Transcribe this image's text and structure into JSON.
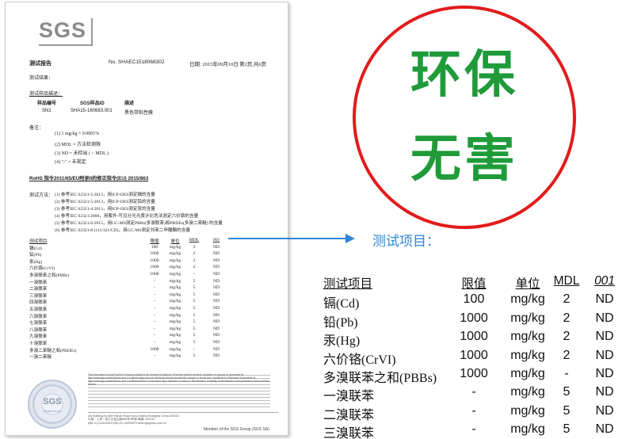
{
  "report": {
    "logo": "SGS",
    "title": "测试报告",
    "report_no": "No. SHAEC1518068302",
    "date": "日期: 2015年09月10日",
    "page": "第2页,共6页",
    "results_label": "测试结果：",
    "sample_desc_label": "测试样品描述：",
    "sample_headers": [
      "样品编号",
      "SGS样品ID",
      "描述"
    ],
    "sample_values": [
      "SN1",
      "SHA15-180683.001",
      "黑色带粘性膜"
    ],
    "notes_label": "备注：",
    "notes": [
      "(1) 1 mg/kg = 0.0001%",
      "(2) MDL = 方法检测限",
      "(3) ND = 未检出 ( < MDL )",
      "(4) \"-\" = 未规定"
    ],
    "rohs_heading": "RoHS 指令2011/65/EU附录II的修正指令(EU) 2015/863",
    "method_label": "测试方法：",
    "methods": [
      "(1) 参考IEC 62321-5:2013，用ICP-OES测定镉的含量",
      "(2) 参考IEC 62321-5:2013，用ICP-OES测定铅的含量",
      "(3) 参考IEC 62321-4:2013，用ICP-OES测定汞的含量",
      "(4) 参考IEC 62321:2008，用紫外-可见分光光度计比色法测定六价铬的含量",
      "(5) 参考IEC 62321-6:2015，用GC-MS测定PBBs(多溴联苯)和PBDEs(多溴二苯醚) 的含量",
      "(6) 参考IEC 62321-8 (111/321/CD)，用GC-MS测定邻苯二甲酸酯的含量"
    ],
    "table_headers": [
      "测试项目",
      "限值",
      "单位",
      "MDL",
      "001"
    ],
    "table_rows": [
      [
        "镉(Cd)",
        "100",
        "mg/kg",
        "2",
        "ND"
      ],
      [
        "铅(Pb)",
        "1000",
        "mg/kg",
        "2",
        "ND"
      ],
      [
        "汞(Hg)",
        "1000",
        "mg/kg",
        "2",
        "ND"
      ],
      [
        "六价铬(CrVI)",
        "1000",
        "mg/kg",
        "2",
        "ND"
      ],
      [
        "多溴联苯之和(PBBs)",
        "1000",
        "mg/kg",
        "-",
        "ND"
      ],
      [
        "一溴联苯",
        "-",
        "mg/kg",
        "5",
        "ND"
      ],
      [
        "二溴联苯",
        "-",
        "mg/kg",
        "5",
        "ND"
      ],
      [
        "三溴联苯",
        "-",
        "mg/kg",
        "5",
        "ND"
      ],
      [
        "四溴联苯",
        "-",
        "mg/kg",
        "5",
        "ND"
      ],
      [
        "五溴联苯",
        "-",
        "mg/kg",
        "5",
        "ND"
      ],
      [
        "六溴联苯",
        "-",
        "mg/kg",
        "5",
        "ND"
      ],
      [
        "七溴联苯",
        "-",
        "mg/kg",
        "5",
        "ND"
      ],
      [
        "八溴联苯",
        "-",
        "mg/kg",
        "5",
        "ND"
      ],
      [
        "九溴联苯",
        "-",
        "mg/kg",
        "5",
        "ND"
      ],
      [
        "十溴联苯",
        "-",
        "mg/kg",
        "5",
        "ND"
      ],
      [
        "多溴二苯醚之和(PBDEs)",
        "1000",
        "mg/kg",
        "-",
        "ND"
      ],
      [
        "一溴二苯醚",
        "-",
        "mg/kg",
        "5",
        "ND"
      ]
    ],
    "fine_print": "This document is issued by the Company subject to its General Conditions of Service printed overleaf, available on request or accessible at http://www.sgs.com/en/Terms-and-Conditions.aspx and, for electronic format documents, subject to Terms and Conditions for Electronic Documents at http://www.sgs.com/en/Terms-and-Conditions/Terms-e-Document.aspx. Attention is drawn to the limitation of liability, indemnification and jurisdiction issues defined therein.",
    "footer_addr_cn": "中国・上海・徐汇区宜山路889号3号楼 邮编: 200233",
    "footer_addr_en": "3rd Building,No.889 Yishan Road Xuhui District,Shanghai China 200233",
    "footer_tel": "t(86–21) 61402553  f(86–21) 64953679  www.sgsgroup.com.cn",
    "member": "Member of the SGS Group (SGS SA)",
    "seal_text": "SGS",
    "seal_sub": "Testing Service"
  },
  "badge": {
    "line1": "环保",
    "line2": "无害",
    "ring_color": "#e21b1b",
    "text_color": "#1f9b3a"
  },
  "callout": {
    "title": "测试项目：",
    "arrow_color": "#2f87d8"
  },
  "zoom_table": {
    "headers": [
      "测试项目",
      "限值",
      "单位",
      "MDL",
      "001"
    ],
    "rows": [
      [
        "镉(Cd)",
        "100",
        "mg/kg",
        "2",
        "ND"
      ],
      [
        "铅(Pb)",
        "1000",
        "mg/kg",
        "2",
        "ND"
      ],
      [
        "汞(Hg)",
        "1000",
        "mg/kg",
        "2",
        "ND"
      ],
      [
        "六价铬(CrVI)",
        "1000",
        "mg/kg",
        "2",
        "ND"
      ],
      [
        "多溴联苯之和(PBBs)",
        "1000",
        "mg/kg",
        "-",
        "ND"
      ],
      [
        "一溴联苯",
        "-",
        "mg/kg",
        "5",
        "ND"
      ],
      [
        "二溴联苯",
        "-",
        "mg/kg",
        "5",
        "ND"
      ],
      [
        "三溴联苯",
        "-",
        "mg/kg",
        "5",
        "ND"
      ]
    ]
  }
}
